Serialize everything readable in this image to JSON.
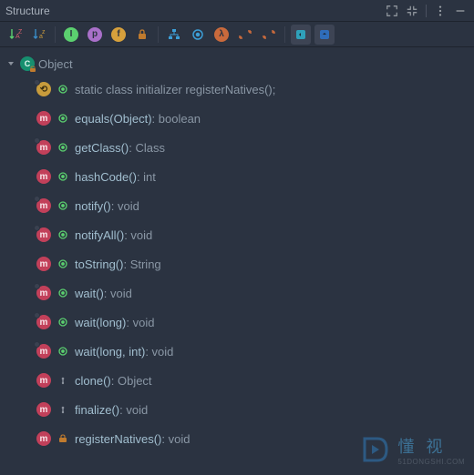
{
  "title": "Structure",
  "root": {
    "label": "Object"
  },
  "toolbar": {
    "sort_alpha": "↓AZ",
    "sort_visibility": "↓az"
  },
  "members": [
    {
      "kind": "init",
      "vis": "public",
      "overlay": true,
      "label": "static class initializer",
      "sig": "  registerNatives();",
      "ret": ""
    },
    {
      "kind": "method",
      "vis": "public",
      "overlay": false,
      "label": "equals(Object)",
      "sig": "",
      "ret": ": boolean"
    },
    {
      "kind": "method",
      "vis": "public",
      "overlay": true,
      "label": "getClass()",
      "sig": "",
      "ret": ": Class<?>"
    },
    {
      "kind": "method",
      "vis": "public",
      "overlay": false,
      "label": "hashCode()",
      "sig": "",
      "ret": ": int"
    },
    {
      "kind": "method",
      "vis": "public",
      "overlay": true,
      "label": "notify()",
      "sig": "",
      "ret": ": void"
    },
    {
      "kind": "method",
      "vis": "public",
      "overlay": true,
      "label": "notifyAll()",
      "sig": "",
      "ret": ": void"
    },
    {
      "kind": "method",
      "vis": "public",
      "overlay": false,
      "label": "toString()",
      "sig": "",
      "ret": ": String"
    },
    {
      "kind": "method",
      "vis": "public",
      "overlay": true,
      "label": "wait()",
      "sig": "",
      "ret": ": void"
    },
    {
      "kind": "method",
      "vis": "public",
      "overlay": true,
      "label": "wait(long)",
      "sig": "",
      "ret": ": void"
    },
    {
      "kind": "method",
      "vis": "public",
      "overlay": true,
      "label": "wait(long, int)",
      "sig": "",
      "ret": ": void"
    },
    {
      "kind": "method",
      "vis": "protected",
      "overlay": false,
      "label": "clone()",
      "sig": "",
      "ret": ": Object"
    },
    {
      "kind": "method",
      "vis": "protected",
      "overlay": false,
      "label": "finalize()",
      "sig": "",
      "ret": ": void"
    },
    {
      "kind": "method",
      "vis": "private",
      "overlay": false,
      "label": "registerNatives()",
      "sig": "",
      "ret": ": void"
    }
  ],
  "watermark": {
    "main": "懂 视",
    "sub": "51DONGSHI.COM"
  }
}
